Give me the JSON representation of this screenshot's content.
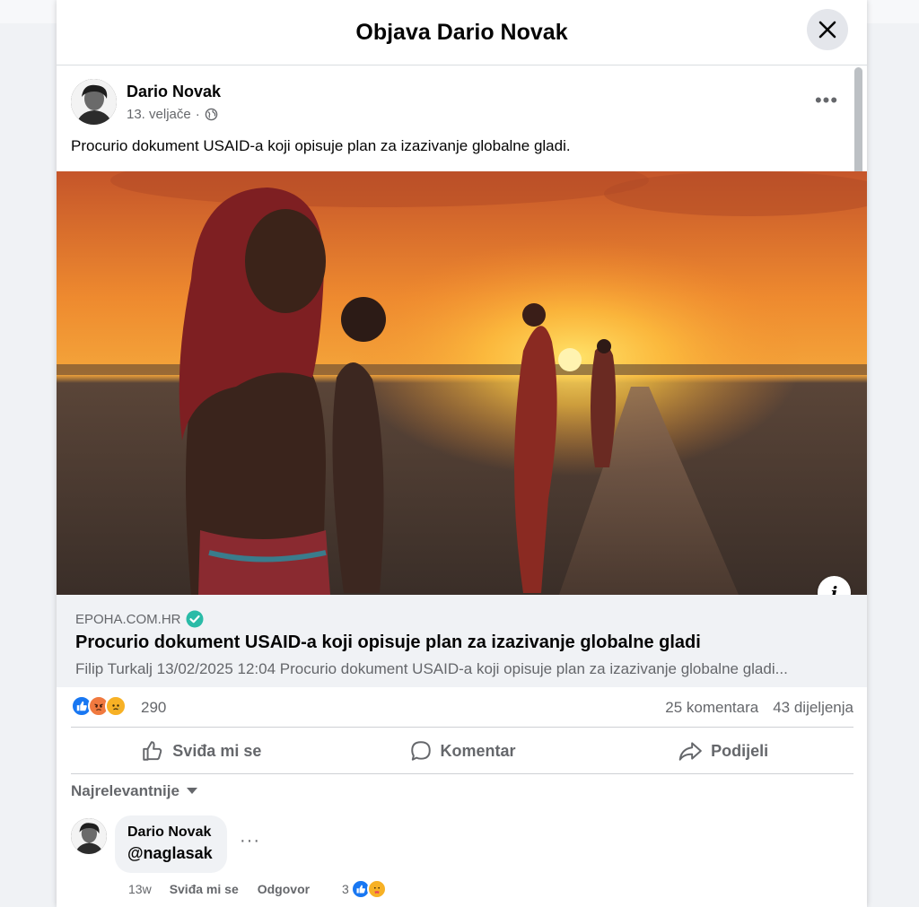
{
  "modal": {
    "title": "Objava Dario Novak"
  },
  "post": {
    "author": "Dario Novak",
    "date": "13. veljače",
    "separator": "·",
    "privacy_icon": "globe-icon",
    "text": "Procurio dokument USAID-a koji opisuje plan za izazivanje globalne gladi.",
    "more_label": "•••"
  },
  "link_preview": {
    "domain": "EPOHA.COM.HR",
    "title": "Procurio dokument USAID-a koji opisuje plan za izazivanje globalne gladi",
    "description": "Filip Turkalj 13/02/2025 12:04 Procurio dokument USAID-a koji opisuje plan za izazivanje globalne gladi...",
    "info_label": "i"
  },
  "stats": {
    "reaction_icons": [
      "like-icon",
      "angry-icon",
      "sad-icon"
    ],
    "reaction_count": "290",
    "comments": "25 komentara",
    "shares": "43 dijeljenja"
  },
  "actions": {
    "like": "Sviđa mi se",
    "comment": "Komentar",
    "share": "Podijeli"
  },
  "comments_section": {
    "sort_label": "Najrelevantnije",
    "comments": [
      {
        "author": "Dario Novak",
        "text": "@naglasak",
        "more_label": "···",
        "time": "13w",
        "like_label": "Sviđa mi se",
        "reply_label": "Odgovor",
        "reaction_count": "3",
        "reaction_icons": [
          "like-icon",
          "care-icon"
        ]
      }
    ]
  },
  "colors": {
    "accent": "#1877f2",
    "verified": "#2abba7",
    "angry": "#f0793f",
    "sad": "#f7b125"
  }
}
